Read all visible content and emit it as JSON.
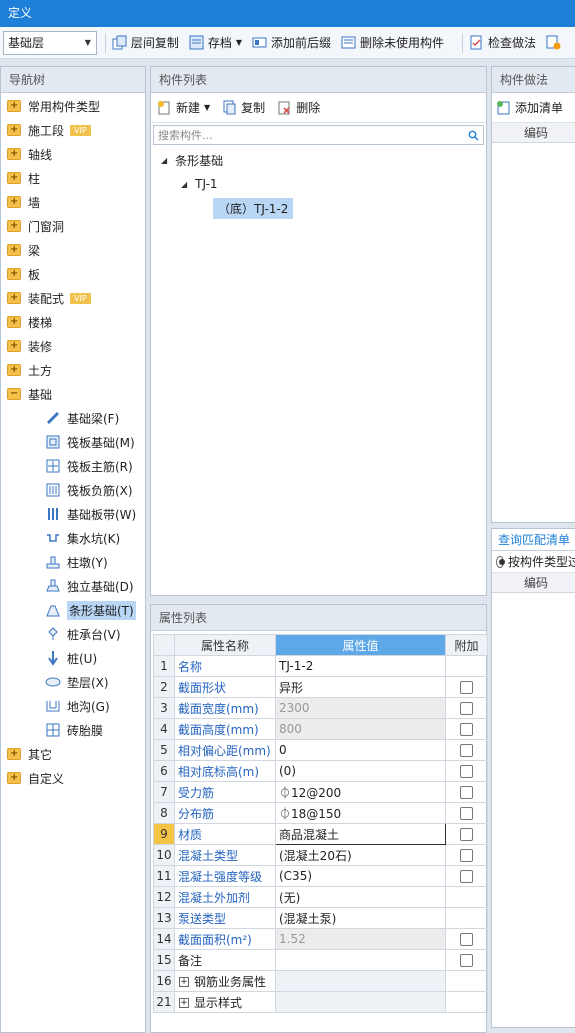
{
  "window": {
    "title": "定义"
  },
  "toolbar": {
    "layer_value": "基础层",
    "copy_between_layers": "层间复制",
    "archive": "存档",
    "add_prefix_suffix": "添加前后缀",
    "delete_unused": "删除未使用构件",
    "check_method": "检查做法"
  },
  "nav_tree": {
    "title": "导航树",
    "vip_badge": "VIP",
    "items": [
      {
        "label": "常用构件类型"
      },
      {
        "label": "施工段",
        "vip": true
      },
      {
        "label": "轴线"
      },
      {
        "label": "柱"
      },
      {
        "label": "墙"
      },
      {
        "label": "门窗洞"
      },
      {
        "label": "梁"
      },
      {
        "label": "板"
      },
      {
        "label": "装配式",
        "vip": true
      },
      {
        "label": "楼梯"
      },
      {
        "label": "装修"
      },
      {
        "label": "土方"
      },
      {
        "label": "基础",
        "expanded": true
      }
    ],
    "children": [
      {
        "label": "基础梁(F)",
        "icon": "beam-icon"
      },
      {
        "label": "筏板基础(M)",
        "icon": "raft-icon"
      },
      {
        "label": "筏板主筋(R)",
        "icon": "raft-main-rebar-icon"
      },
      {
        "label": "筏板负筋(X)",
        "icon": "raft-neg-rebar-icon"
      },
      {
        "label": "基础板带(W)",
        "icon": "slab-strip-icon"
      },
      {
        "label": "集水坑(K)",
        "icon": "sump-pit-icon"
      },
      {
        "label": "柱墩(Y)",
        "icon": "column-pier-icon"
      },
      {
        "label": "独立基础(D)",
        "icon": "isolated-footing-icon"
      },
      {
        "label": "条形基础(T)",
        "icon": "strip-footing-icon",
        "selected": true
      },
      {
        "label": "桩承台(V)",
        "icon": "pile-cap-icon"
      },
      {
        "label": "桩(U)",
        "icon": "pile-icon"
      },
      {
        "label": "垫层(X)",
        "icon": "cushion-icon"
      },
      {
        "label": "地沟(G)",
        "icon": "trench-icon"
      },
      {
        "label": "砖胎膜",
        "icon": "brick-mold-icon"
      }
    ],
    "tail": [
      {
        "label": "其它"
      },
      {
        "label": "自定义"
      }
    ]
  },
  "component_list": {
    "title": "构件列表",
    "new": "新建",
    "copy": "复制",
    "delete": "删除",
    "search_placeholder": "搜索构件...",
    "tree": {
      "root": "条形基础",
      "child": "TJ-1",
      "leaf": "（底）TJ-1-2"
    }
  },
  "component_method": {
    "title": "构件做法",
    "add_list": "添加清单",
    "col_code": "编码",
    "query_tab": "查询匹配清单",
    "radio_label": "按构件类型过",
    "col_code2": "编码"
  },
  "property_list": {
    "title": "属性列表",
    "col_name": "属性名称",
    "col_value": "属性值",
    "col_extra": "附加",
    "rows": [
      {
        "no": "1",
        "name": "名称",
        "value": "TJ-1-2",
        "blue": true,
        "check": false,
        "grey": false
      },
      {
        "no": "2",
        "name": "截面形状",
        "value": "异形",
        "blue": true,
        "check": true,
        "grey": false
      },
      {
        "no": "3",
        "name": "截面宽度(mm)",
        "value": "2300",
        "blue": true,
        "check": true,
        "grey": true
      },
      {
        "no": "4",
        "name": "截面高度(mm)",
        "value": "800",
        "blue": true,
        "check": true,
        "grey": true
      },
      {
        "no": "5",
        "name": "相对偏心距(mm)",
        "value": "0",
        "blue": true,
        "check": true,
        "grey": false
      },
      {
        "no": "6",
        "name": "相对底标高(m)",
        "value": "(0)",
        "blue": true,
        "check": true,
        "grey": false
      },
      {
        "no": "7",
        "name": "受力筋",
        "value": "⏀12@200",
        "blue": true,
        "check": true,
        "grey": false
      },
      {
        "no": "8",
        "name": "分布筋",
        "value": "⏀18@150",
        "blue": true,
        "check": true,
        "grey": false
      },
      {
        "no": "9",
        "name": "材质",
        "value": "商品混凝土",
        "blue": true,
        "check": true,
        "grey": false,
        "current": true
      },
      {
        "no": "10",
        "name": "混凝土类型",
        "value": "(混凝土20石)",
        "blue": true,
        "check": true,
        "grey": false
      },
      {
        "no": "11",
        "name": "混凝土强度等级",
        "value": "(C35)",
        "blue": true,
        "check": true,
        "grey": false
      },
      {
        "no": "12",
        "name": "混凝土外加剂",
        "value": "(无)",
        "blue": true,
        "check": false,
        "grey": false
      },
      {
        "no": "13",
        "name": "泵送类型",
        "value": "(混凝土泵)",
        "blue": true,
        "check": false,
        "grey": false
      },
      {
        "no": "14",
        "name": "截面面积(m²)",
        "value": "1.52",
        "blue": true,
        "check": true,
        "grey": true
      },
      {
        "no": "15",
        "name": "备注",
        "value": "",
        "blue": false,
        "check": true,
        "grey": false
      }
    ],
    "groups": [
      {
        "no": "16",
        "name": "钢筋业务属性"
      },
      {
        "no": "21",
        "name": "显示样式"
      }
    ]
  }
}
